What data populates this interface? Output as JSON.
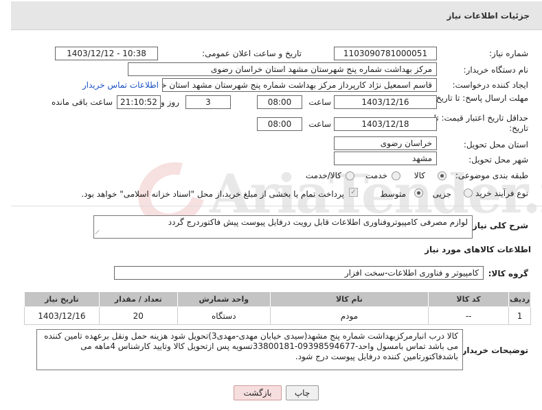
{
  "page": {
    "title": "جزئیات اطلاعات نیاز",
    "watermark": "AriaTender.neT"
  },
  "fields": {
    "need_number_label": "شماره نیاز:",
    "need_number": "1103090781000051",
    "announce_label": "تاریخ و ساعت اعلان عمومی:",
    "announce_value": "1403/12/12 - 10:38",
    "buyer_label": "نام دستگاه خریدار:",
    "buyer_value": "مرکز بهداشت شماره پنج شهرستان مشهد استان خراسان رضوی",
    "creator_label": "ایجاد کننده درخواست:",
    "creator_value": "قاسم  اسمعیل نژاد کارپرداز مرکز بهداشت شماره پنج شهرستان مشهد استان خراسان رضوی",
    "buyer_contact_link": "اطلاعات تماس خریدار",
    "deadline_label": "مهلت ارسال پاسخ: تا تاریخ:",
    "deadline_date": "1403/12/16",
    "time_label": "ساعت",
    "deadline_time": "08:00",
    "days_value": "3",
    "days_label": "روز و",
    "remaining_time": "21:10:52",
    "remaining_label": "ساعت باقی مانده",
    "validity_label": "حداقل تاریخ اعتبار قیمت: تا تاریخ:",
    "validity_date": "1403/12/18",
    "validity_time": "08:00",
    "province_label": "استان محل تحویل:",
    "province_value": "خراسان رضوی",
    "city_label": "شهر محل تحویل:",
    "city_value": "مشهد",
    "category_label": "طبقه بندی موضوعی:",
    "category_options": [
      "کالا",
      "خدمت",
      "کالا/خدمت"
    ],
    "process_label": "نوع فرآیند خرید :",
    "process_options": [
      "جزیی",
      "متوسط"
    ],
    "payment_note": "پرداخت تمام یا بخشی از مبلغ خرید،از محل \"اسناد خزانه اسلامی\" خواهد بود."
  },
  "description": {
    "label": "شرح کلی نیاز:",
    "text": "لوازم مصرفی کامپیوتروفناوری اطلاعات قابل رویت درفایل پیوست پیش فاکتوردرج گردد"
  },
  "goods": {
    "section_title": "اطلاعات کالاهای مورد نیاز",
    "group_label": "گروه کالا:",
    "group_value": "کامپیوتر و فناوری اطلاعات-سخت افزار",
    "columns": [
      "ردیف",
      "کد کالا",
      "نام کالا",
      "واحد شمارش",
      "تعداد / مقدار",
      "تاریخ نیاز"
    ],
    "rows": [
      [
        "1",
        "--",
        "مودم",
        "دستگاه",
        "20",
        "1403/12/16"
      ]
    ]
  },
  "buyer_notes": {
    "label": "توضیحات خریدار:",
    "text": "کالا درب انبارمرکزبهداشت شماره پنج مشهد(سیدی خیابان مهدی-مهدی3)تحویل شود هزینه حمل ونقل برعهده تامین کننده می باشد  تماس بامسول واحد-09398594677-33800181تسویه پس ازتحویل کالا وتایید کارشناس 4ماهه می باشدفاکتورتامین کننده درفایل پیوست درج شود."
  },
  "buttons": {
    "print": "چاپ",
    "back": "بازگشت"
  }
}
